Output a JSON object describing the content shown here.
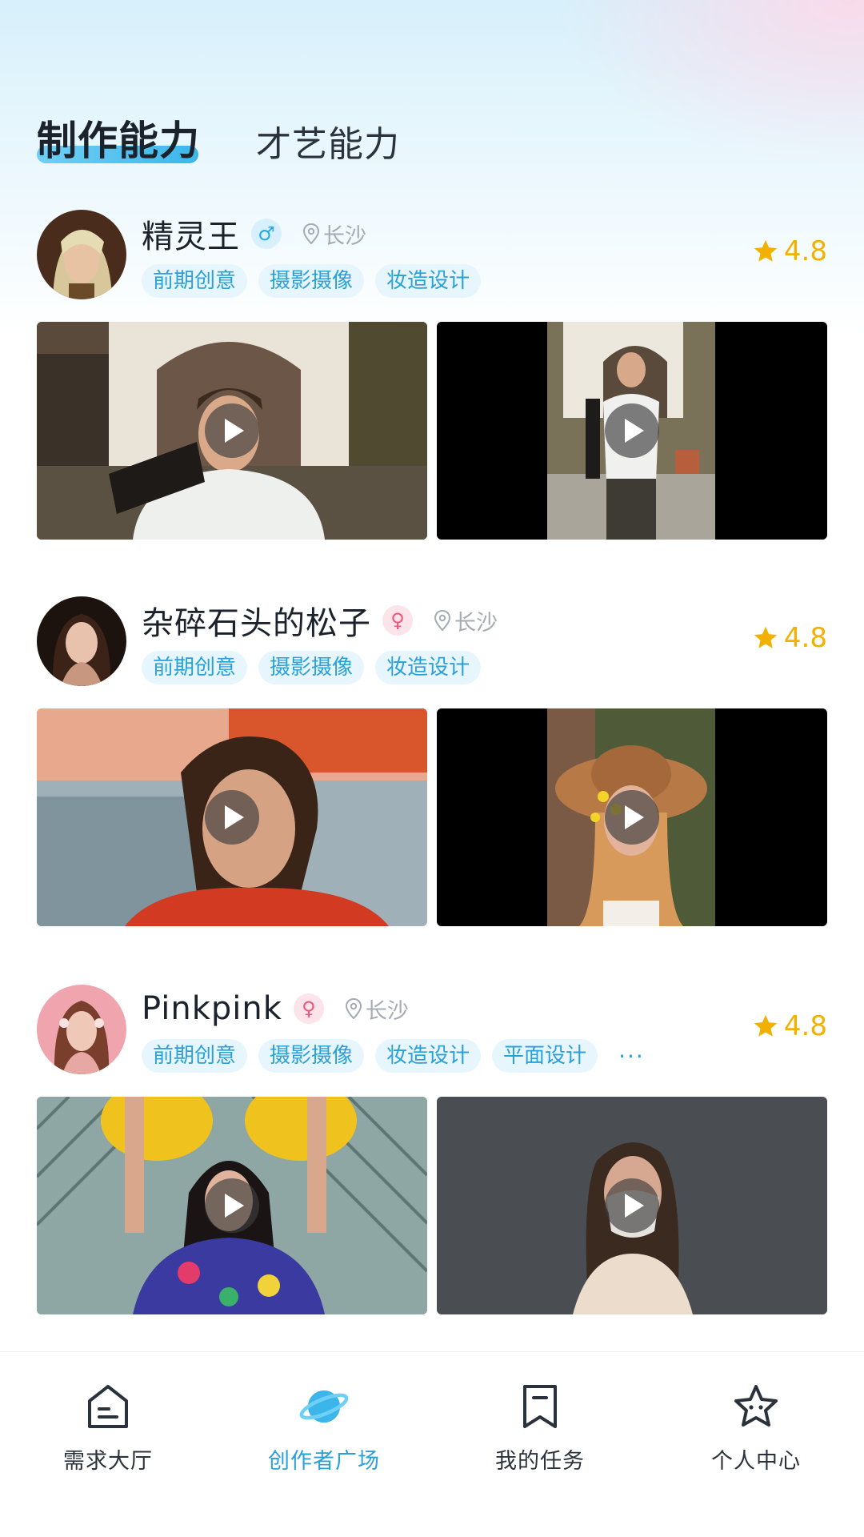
{
  "tabs": [
    {
      "label": "制作能力",
      "active": true
    },
    {
      "label": "才艺能力",
      "active": false
    }
  ],
  "creators": [
    {
      "name": "精灵王",
      "gender": "male",
      "gender_icon": "male-icon",
      "location": "长沙",
      "tags": [
        "前期创意",
        "摄影摄像",
        "妆造设计"
      ],
      "more": "",
      "rating": "4.8"
    },
    {
      "name": "杂碎石头的松子",
      "gender": "female",
      "gender_icon": "female-icon",
      "location": "长沙",
      "tags": [
        "前期创意",
        "摄影摄像",
        "妆造设计"
      ],
      "more": "",
      "rating": "4.8"
    },
    {
      "name": "Pinkpink",
      "gender": "female",
      "gender_icon": "female-icon",
      "location": "长沙",
      "tags": [
        "前期创意",
        "摄影摄像",
        "妆造设计",
        "平面设计"
      ],
      "more": "···",
      "rating": "4.8"
    }
  ],
  "bottom_nav": [
    {
      "label": "需求大厅",
      "icon": "home-icon",
      "active": false
    },
    {
      "label": "创作者广场",
      "icon": "planet-icon",
      "active": true
    },
    {
      "label": "我的任务",
      "icon": "bookmark-icon",
      "active": false
    },
    {
      "label": "个人中心",
      "icon": "star-face-icon",
      "active": false
    }
  ],
  "colors": {
    "accent": "#2aa0d8",
    "rating": "#f2b100",
    "female": "#f0577c",
    "male": "#2aa8e2"
  }
}
